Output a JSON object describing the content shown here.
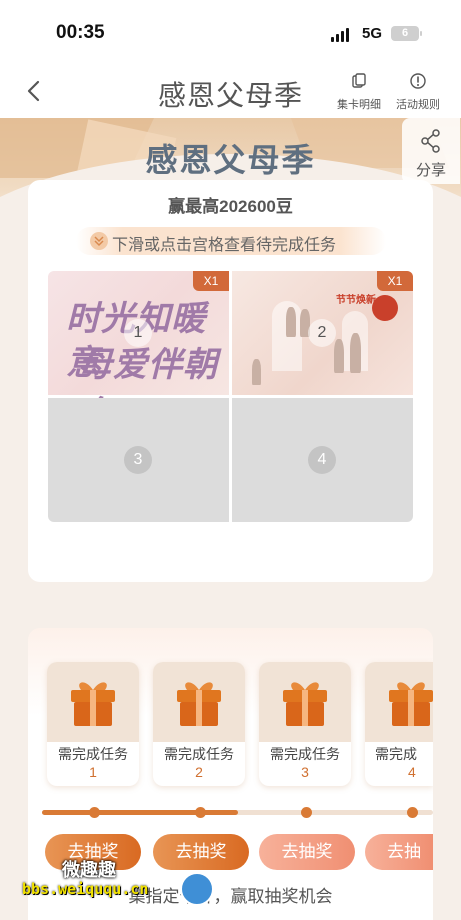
{
  "status_bar": {
    "time": "00:35",
    "network": "5G",
    "battery": "6"
  },
  "nav": {
    "title": "感恩父母季",
    "card_details": "集卡明细",
    "rules": "活动规则"
  },
  "banner": {
    "title": "感恩父母季",
    "share": "分享"
  },
  "card_section": {
    "subtitle": "赢最高202600豆",
    "hint": "下滑或点击宫格查看待完成任务",
    "cells": [
      {
        "num": "1",
        "tag": "X1",
        "art_line1": "时光知暖意",
        "art_line2": "母爱伴朝夕"
      },
      {
        "num": "2",
        "tag": "X1",
        "art_caption": "节节焕新"
      },
      {
        "num": "3"
      },
      {
        "num": "4"
      }
    ]
  },
  "prizes": {
    "items": [
      {
        "label": "需完成任务",
        "num": "1"
      },
      {
        "label": "需完成任务",
        "num": "2"
      },
      {
        "label": "需完成任务",
        "num": "3"
      },
      {
        "label": "需完成",
        "num": "4"
      }
    ],
    "buttons": [
      "去抽奖",
      "去抽奖",
      "去抽奖",
      "去抽"
    ],
    "progress_percent": 50,
    "note": "集指定卡片，赢取抽奖机会"
  },
  "watermark": {
    "line1": "微趣趣",
    "line2": "bbs.weiququ.cn"
  },
  "colors": {
    "accent": "#d96a22",
    "accent_light": "#f08f72",
    "title": "#5f6f80"
  }
}
